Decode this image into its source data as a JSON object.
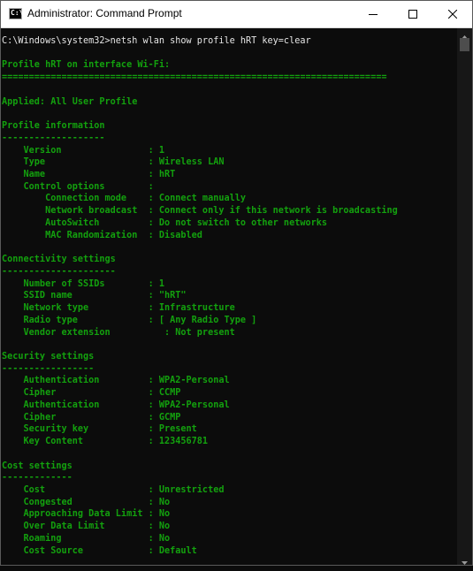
{
  "window": {
    "title": "Administrator: Command Prompt",
    "icon": "cmd-icon",
    "icon_text": "C:\\",
    "buttons": [
      "minimize-icon",
      "maximize-icon",
      "close-icon"
    ]
  },
  "colors": {
    "console_bg": "#0c0c0c",
    "console_fg": "#13a10e",
    "titlebar_bg": "#ffffff"
  },
  "console": {
    "lines": [
      {
        "row": 0,
        "text": "C:\\Windows\\system32>netsh wlan show profile hRT key=clear",
        "style": "white"
      },
      {
        "row": 2,
        "text": "Profile hRT on interface Wi-Fi:"
      },
      {
        "row": 3,
        "text": "======================================================================="
      },
      {
        "row": 5,
        "text": "Applied: All User Profile"
      },
      {
        "row": 7,
        "text": "Profile information"
      },
      {
        "row": 8,
        "text": "-------------------"
      },
      {
        "row": 9,
        "text": "    Version                : 1"
      },
      {
        "row": 10,
        "text": "    Type                   : Wireless LAN"
      },
      {
        "row": 11,
        "text": "    Name                   : hRT"
      },
      {
        "row": 12,
        "text": "    Control options        :"
      },
      {
        "row": 13,
        "text": "        Connection mode    : Connect manually"
      },
      {
        "row": 14,
        "text": "        Network broadcast  : Connect only if this network is broadcasting"
      },
      {
        "row": 15,
        "text": "        AutoSwitch         : Do not switch to other networks"
      },
      {
        "row": 16,
        "text": "        MAC Randomization  : Disabled"
      },
      {
        "row": 18,
        "text": "Connectivity settings"
      },
      {
        "row": 19,
        "text": "---------------------"
      },
      {
        "row": 20,
        "text": "    Number of SSIDs        : 1"
      },
      {
        "row": 21,
        "text": "    SSID name              : \"hRT\""
      },
      {
        "row": 22,
        "text": "    Network type           : Infrastructure"
      },
      {
        "row": 23,
        "text": "    Radio type             : [ Any Radio Type ]"
      },
      {
        "row": 24,
        "text": "    Vendor extension          : Not present"
      },
      {
        "row": 26,
        "text": "Security settings"
      },
      {
        "row": 27,
        "text": "-----------------"
      },
      {
        "row": 28,
        "text": "    Authentication         : WPA2-Personal"
      },
      {
        "row": 29,
        "text": "    Cipher                 : CCMP"
      },
      {
        "row": 30,
        "text": "    Authentication         : WPA2-Personal"
      },
      {
        "row": 31,
        "text": "    Cipher                 : GCMP"
      },
      {
        "row": 32,
        "text": "    Security key           : Present"
      },
      {
        "row": 33,
        "text": "    Key Content            : 123456781"
      },
      {
        "row": 35,
        "text": "Cost settings"
      },
      {
        "row": 36,
        "text": "-------------"
      },
      {
        "row": 37,
        "text": "    Cost                   : Unrestricted"
      },
      {
        "row": 38,
        "text": "    Congested              : No"
      },
      {
        "row": 39,
        "text": "    Approaching Data Limit : No"
      },
      {
        "row": 40,
        "text": "    Over Data Limit        : No"
      },
      {
        "row": 41,
        "text": "    Roaming                : No"
      },
      {
        "row": 42,
        "text": "    Cost Source            : Default"
      }
    ]
  }
}
